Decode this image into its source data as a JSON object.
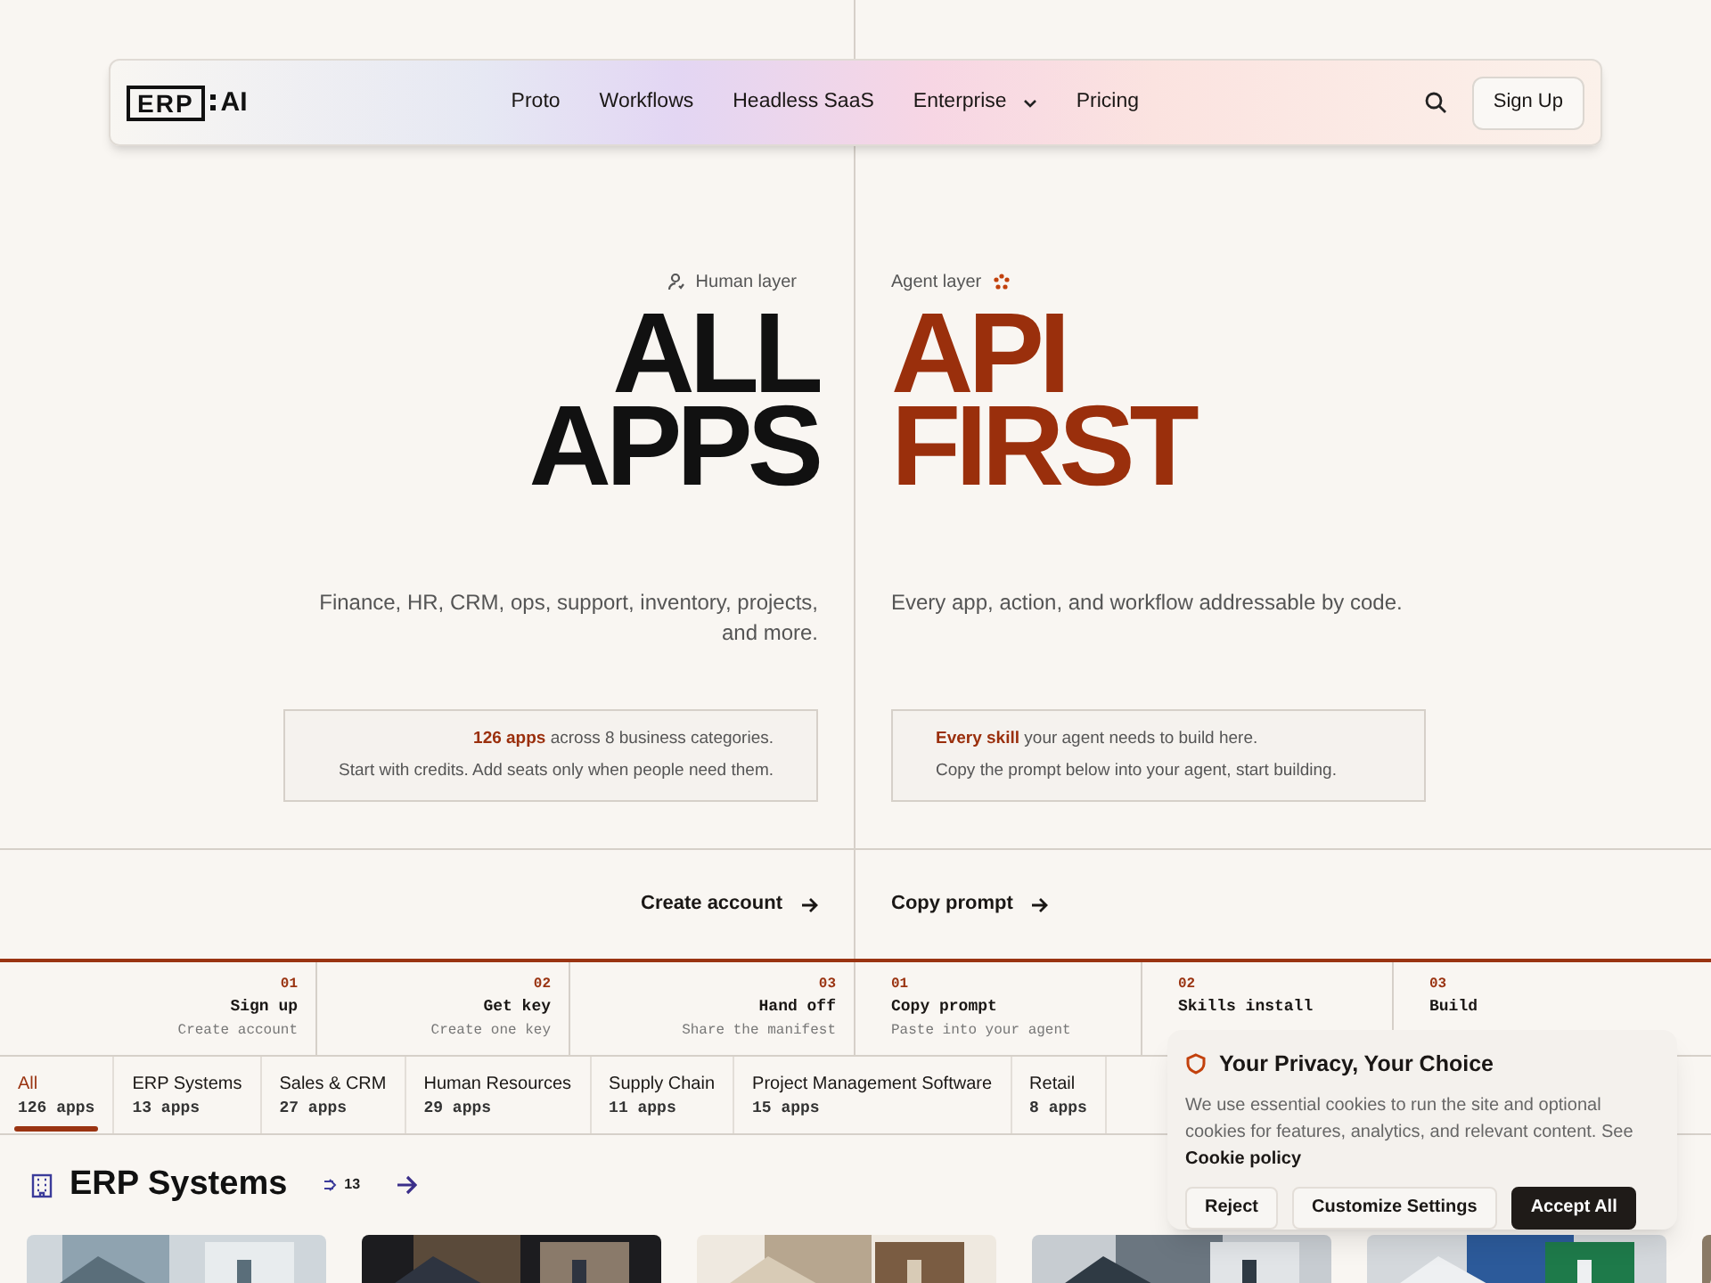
{
  "nav": {
    "logo_left": "ERP",
    "logo_right": "AI",
    "links": [
      {
        "label": "Proto",
        "has_menu": false
      },
      {
        "label": "Workflows",
        "has_menu": false
      },
      {
        "label": "Headless SaaS",
        "has_menu": false
      },
      {
        "label": "Enterprise",
        "has_menu": true
      },
      {
        "label": "Pricing",
        "has_menu": false
      }
    ],
    "cta": "Sign Up"
  },
  "hero": [
    {
      "badge": "Human layer",
      "title_lines": [
        "ALL",
        "APPS"
      ],
      "description": "Finance, HR, CRM, ops, support, inventory, projects, and more.",
      "info": [
        "**126 apps** across 8 business categories.",
        "Start with credits. Add seats only when people need them."
      ],
      "cta": "Create account"
    },
    {
      "badge": "Agent layer",
      "title_lines": [
        "API",
        "FIRST"
      ],
      "description": "Every app, action, and workflow addressable by code.",
      "info": [
        "**Every skill** your agent needs to build here.",
        "Copy the prompt below into your agent, start building."
      ],
      "cta": "Copy prompt"
    }
  ],
  "steps": [
    {
      "number": "01",
      "title": "Sign up",
      "subtitle": "Create account"
    },
    {
      "number": "02",
      "title": "Get key",
      "subtitle": "Create one key"
    },
    {
      "number": "03",
      "title": "Hand off",
      "subtitle": "Share the manifest"
    },
    {
      "number": "01",
      "title": "Copy prompt",
      "subtitle": "Paste into your agent"
    },
    {
      "number": "02",
      "title": "Skills install"
    },
    {
      "number": "03",
      "title": "Build"
    }
  ],
  "tabs": [
    {
      "label": "All",
      "count": "126 apps",
      "selected": true
    },
    {
      "label": "ERP Systems",
      "count": "13 apps",
      "selected": false
    },
    {
      "label": "Sales & CRM",
      "count": "27 apps",
      "selected": false
    },
    {
      "label": "Human Resources",
      "count": "29 apps",
      "selected": false
    },
    {
      "label": "Supply Chain",
      "count": "11 apps",
      "selected": false
    },
    {
      "label": "Project Management Software",
      "count": "15 apps",
      "selected": false
    },
    {
      "label": "Retail",
      "count": "8 apps",
      "selected": false
    }
  ],
  "section": {
    "title": "ERP Systems",
    "count": "13"
  },
  "cookie": {
    "title": "Your Privacy, Your Choice",
    "text": "We use essential cookies to run the site and optional cookies for features, analytics, and relevant content. See",
    "link": "Cookie policy",
    "buttons": [
      {
        "label": "Reject",
        "kind": "secondary"
      },
      {
        "label": "Customize Settings",
        "kind": "secondary"
      },
      {
        "label": "Accept All",
        "kind": "primary"
      }
    ]
  }
}
